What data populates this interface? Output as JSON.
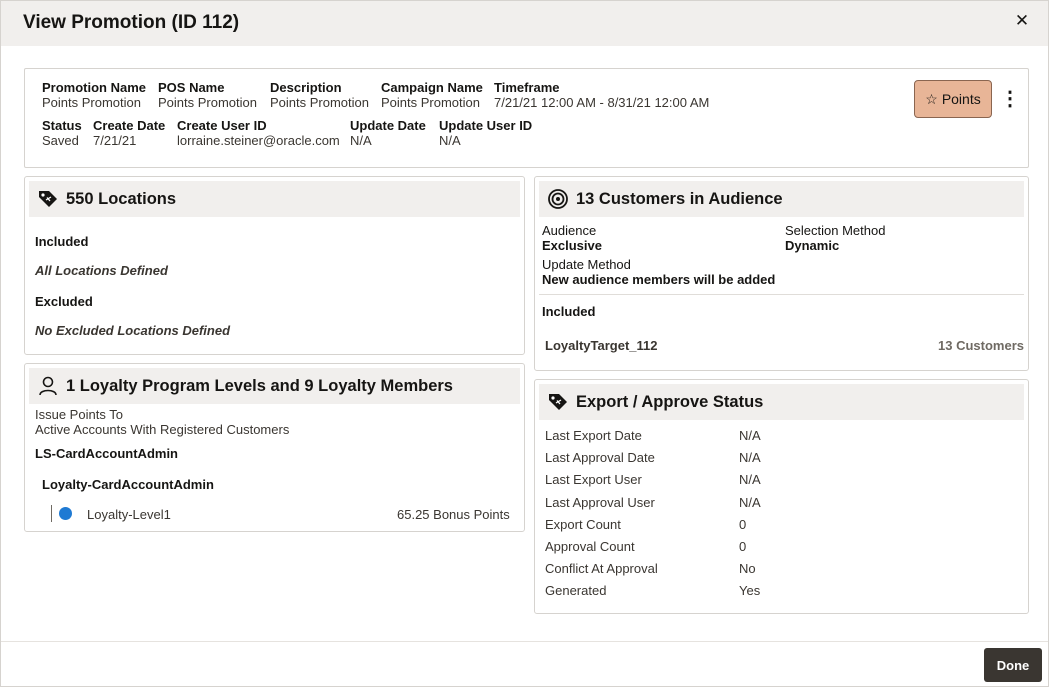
{
  "dialog": {
    "title": "View Promotion (ID 112)",
    "close_glyph": "✕",
    "done_label": "Done"
  },
  "summary": {
    "promotion_name_label": "Promotion Name",
    "promotion_name": "Points Promotion",
    "pos_name_label": "POS Name",
    "pos_name": "Points Promotion",
    "description_label": "Description",
    "description": "Points Promotion",
    "campaign_name_label": "Campaign Name",
    "campaign_name": "Points Promotion",
    "timeframe_label": "Timeframe",
    "timeframe": "7/21/21 12:00 AM - 8/31/21 12:00 AM",
    "status_label": "Status",
    "status": "Saved",
    "create_date_label": "Create Date",
    "create_date": "7/21/21",
    "create_user_label": "Create User ID",
    "create_user": "lorraine.steiner@oracle.com",
    "update_date_label": "Update Date",
    "update_date": "N/A",
    "update_user_label": "Update User ID",
    "update_user": "N/A",
    "points_button_label": "Points",
    "star_glyph": "☆",
    "kebab_glyph": "⋮"
  },
  "locations": {
    "title": "550 Locations",
    "included_label": "Included",
    "included_value": "All Locations Defined",
    "excluded_label": "Excluded",
    "excluded_value": "No Excluded Locations Defined"
  },
  "loyalty": {
    "title": "1 Loyalty Program Levels and 9 Loyalty Members",
    "issue_label": "Issue Points To",
    "issue_value": "Active Accounts With Registered Customers",
    "program": "LS-CardAccountAdmin",
    "sub_program": "Loyalty-CardAccountAdmin",
    "level_name": "Loyalty-Level1",
    "level_points": "65.25 Bonus Points",
    "level_dot_color": "#1f7ad3"
  },
  "audience": {
    "title": "13 Customers in Audience",
    "audience_label": "Audience",
    "audience_value": "Exclusive",
    "selection_label": "Selection Method",
    "selection_value": "Dynamic",
    "update_label": "Update Method",
    "update_value": "New audience members will be added",
    "included_label": "Included",
    "target_name": "LoyaltyTarget_112",
    "target_count": "13 Customers"
  },
  "export": {
    "title": "Export / Approve Status",
    "rows": [
      {
        "label": "Last Export Date",
        "value": "N/A"
      },
      {
        "label": "Last Approval Date",
        "value": "N/A"
      },
      {
        "label": "Last Export User",
        "value": "N/A"
      },
      {
        "label": "Last Approval User",
        "value": "N/A"
      },
      {
        "label": "Export Count",
        "value": "0"
      },
      {
        "label": "Approval Count",
        "value": "0"
      },
      {
        "label": "Conflict At Approval",
        "value": "No"
      },
      {
        "label": "Generated",
        "value": "Yes"
      }
    ]
  },
  "colors": {
    "header_bg": "#f1efed",
    "points_button_bg": "#e8b597",
    "done_button_bg": "#3a3631"
  }
}
